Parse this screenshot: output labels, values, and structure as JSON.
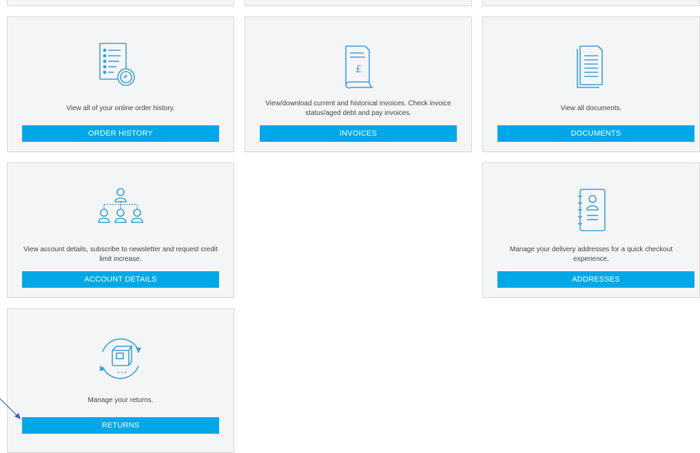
{
  "cards": [
    {
      "key": "order_history",
      "icon": "order-history-icon",
      "description": "View all of your online order history.",
      "button": "ORDER HISTORY"
    },
    {
      "key": "invoices",
      "icon": "invoice-icon",
      "description": "View/download current and historical invoices. Check invoice status/aged debt and pay invoices.",
      "button": "INVOICES"
    },
    {
      "key": "documents",
      "icon": "documents-icon",
      "description": "View all documents.",
      "button": "DOCUMENTS"
    },
    {
      "key": "account_details",
      "icon": "account-hierarchy-icon",
      "description": "View account details, subscribe to newsletter and request credit limit increase.",
      "button": "ACCOUNT DETAILS"
    },
    {
      "key": "addresses",
      "icon": "address-book-icon",
      "description": "Manage your delivery addresses for a quick checkout experience.",
      "button": "ADDRESSES"
    },
    {
      "key": "returns",
      "icon": "returns-icon",
      "description": "Manage your returns.",
      "button": "RETURNS"
    }
  ],
  "colors": {
    "accent": "#00a8e8",
    "icon": "#3a9fd8",
    "card_bg": "#f4f5f6",
    "arrow": "#3b5fc0"
  }
}
